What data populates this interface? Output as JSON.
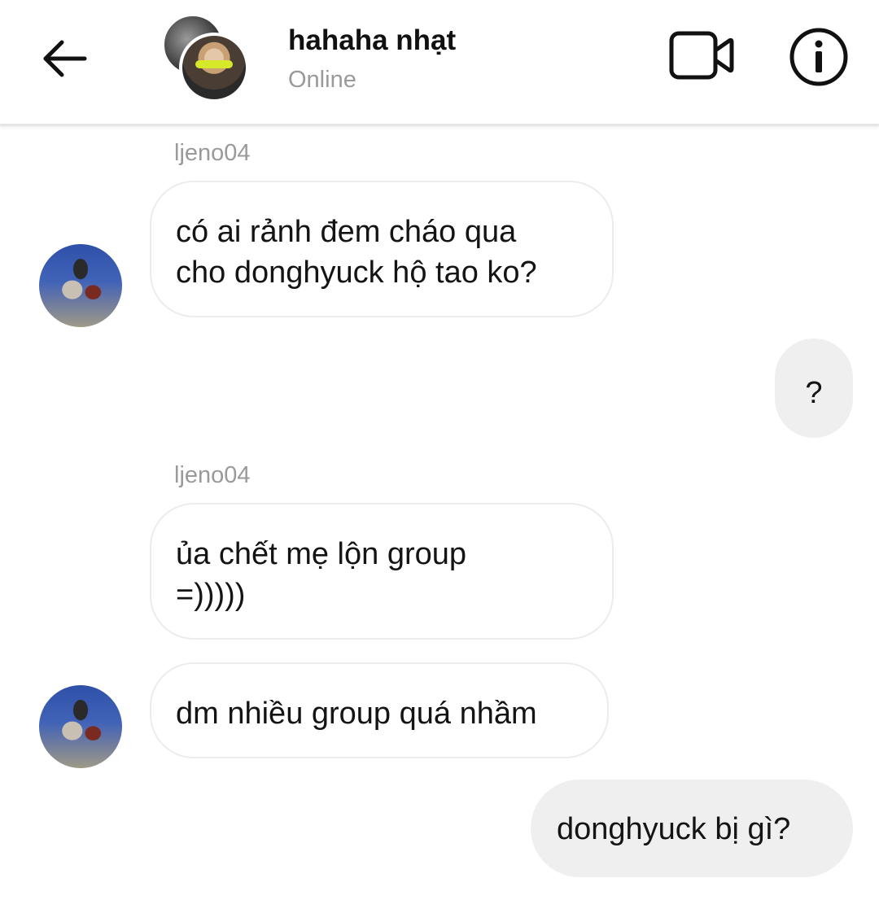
{
  "header": {
    "title": "hahaha nhạt",
    "status": "Online",
    "back_icon": "arrow-left-icon",
    "video_icon": "video-camera-icon",
    "info_icon": "info-icon"
  },
  "messages": [
    {
      "sender": "ljeno04",
      "text_lines": [
        "có ai rảnh đem cháo qua",
        "cho donghyuck hộ tao ko?"
      ]
    },
    {
      "text": "?"
    },
    {
      "sender": "ljeno04",
      "text_lines": [
        "ủa chết mẹ lộn group",
        "=)))))"
      ]
    },
    {
      "text": "dm nhiều group quá nhầm"
    },
    {
      "text": "donghyuck bị gì?"
    }
  ]
}
